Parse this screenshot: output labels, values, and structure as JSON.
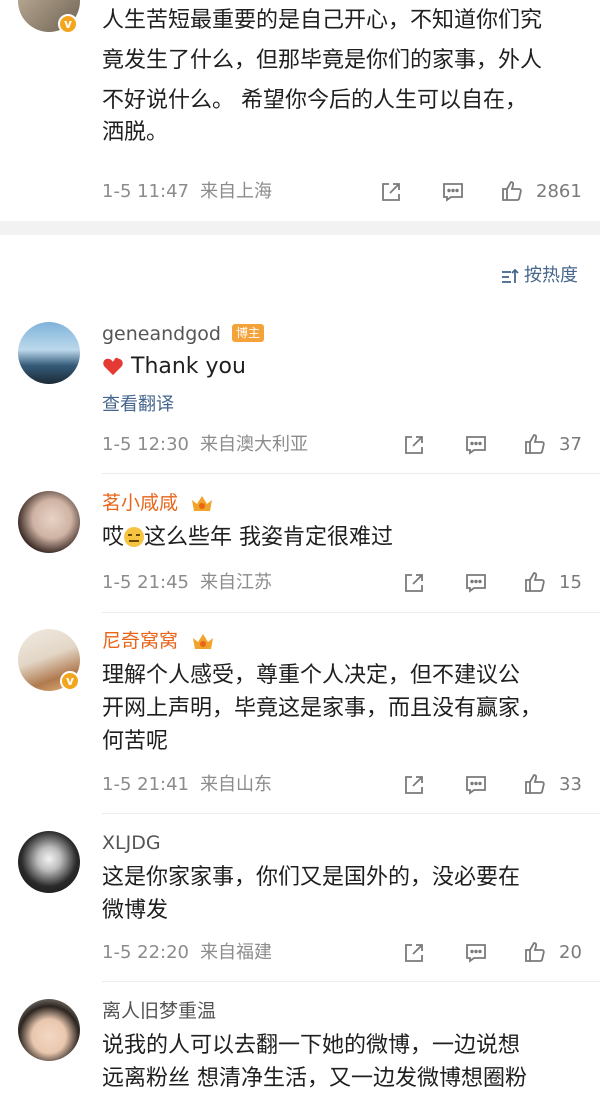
{
  "colors": {
    "accent_link": "#46668c",
    "vip_orange": "#e8651a",
    "meta_gray": "#8c8c8c"
  },
  "top_comment": {
    "text": "人生苦短最重要的是自己开心，不知道你们究竟发生了什么，但那毕竟是你们的家事，外人不好说什么。 希望你今后的人生可以自在，洒脱。",
    "lines": [
      "人生苦短最重要的是自己开心，不知道你们究",
      "竟发生了什么，但那毕竟是你们的家事，外人",
      "不好说什么。 希望你今后的人生可以自在，",
      "洒脱。"
    ],
    "time": "1-5 11:47",
    "location": "来自上海",
    "likes": "2861"
  },
  "sort_label": "按热度",
  "comments": [
    {
      "username": "geneandgod",
      "tag": "博主",
      "text": "Thank you",
      "translate": "查看翻译",
      "time": "1-5 12:30",
      "location": "来自澳大利亚",
      "likes": "37"
    },
    {
      "username": "茗小咸咸",
      "text_before": "哎",
      "text_after": "这么些年 我姿肯定很难过",
      "time": "1-5 21:45",
      "location": "来自江苏",
      "likes": "15"
    },
    {
      "username": "尼奇窝窝",
      "lines": [
        "理解个人感受，尊重个人决定，但不建议公",
        "开网上声明，毕竟这是家事，而且没有赢家，",
        "何苦呢"
      ],
      "time": "1-5 21:41",
      "location": "来自山东",
      "likes": "33"
    },
    {
      "username": "XLJDG",
      "lines": [
        "这是你家家事，你们又是国外的，没必要在",
        "微博发"
      ],
      "time": "1-5 22:20",
      "location": "来自福建",
      "likes": "20"
    },
    {
      "username": "离人旧梦重温",
      "lines": [
        "说我的人可以去翻一下她的微博，一边说想",
        "远离粉丝 想清净生活，又一边发微博想圈粉"
      ]
    }
  ]
}
